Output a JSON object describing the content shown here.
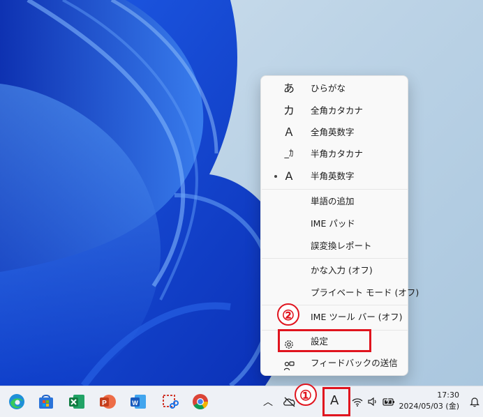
{
  "ime_menu": {
    "items": [
      {
        "glyph": "あ",
        "label": "ひらがな",
        "selected": false
      },
      {
        "glyph": "カ",
        "label": "全角カタカナ",
        "selected": false
      },
      {
        "glyph": "Ａ",
        "label": "全角英数字",
        "selected": false
      },
      {
        "glyph": "_ｶ",
        "label": "半角カタカナ",
        "selected": false
      },
      {
        "glyph": "A",
        "label": "半角英数字",
        "selected": true
      }
    ],
    "tools": [
      "単語の追加",
      "IME パッド",
      "誤変換レポート"
    ],
    "toggles": [
      "かな入力 (オフ)",
      "プライベート モード (オフ)"
    ],
    "toolbar": "IME ツール バー (オフ)",
    "settings": "設定",
    "feedback": "フィードバックの送信"
  },
  "annotations": {
    "badge1": "①",
    "badge2": "②",
    "accent_color": "#e0141e"
  },
  "taskbar": {
    "apps": [
      "edge",
      "microsoft-store",
      "excel",
      "powerpoint",
      "word",
      "snipping-tool",
      "chrome"
    ],
    "ime_indicator": "A",
    "time": "17:30",
    "date": "2024/05/03 (金)"
  }
}
